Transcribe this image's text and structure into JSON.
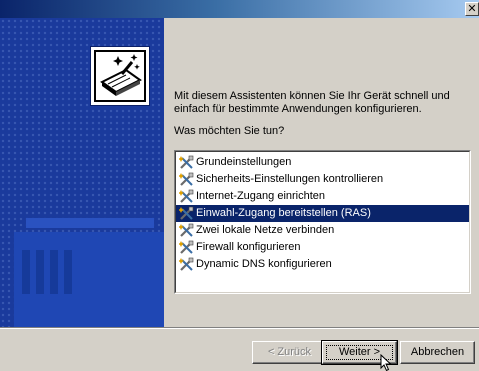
{
  "window": {
    "close_glyph": "✕"
  },
  "wizard": {
    "intro_text": "Mit diesem Assistenten können Sie Ihr Gerät schnell und einfach für bestimmte Anwendungen konfigurieren.",
    "question": "Was möchten Sie tun?",
    "options": [
      {
        "label": "Grundeinstellungen",
        "selected": false
      },
      {
        "label": "Sicherheits-Einstellungen kontrollieren",
        "selected": false
      },
      {
        "label": "Internet-Zugang einrichten",
        "selected": false
      },
      {
        "label": "Einwahl-Zugang bereitstellen (RAS)",
        "selected": true
      },
      {
        "label": "Zwei lokale Netze verbinden",
        "selected": false
      },
      {
        "label": "Firewall konfigurieren",
        "selected": false
      },
      {
        "label": "Dynamic DNS konfigurieren",
        "selected": false
      }
    ],
    "option_icon": "tools-icon"
  },
  "buttons": {
    "back_label": "< Zurück",
    "next_label": "Weiter >",
    "cancel_label": "Abbrechen"
  },
  "colors": {
    "title_active": "#0a246a",
    "side_panel": "#1a3a9c",
    "selection": "#0a246a",
    "face": "#d4d0c8"
  }
}
